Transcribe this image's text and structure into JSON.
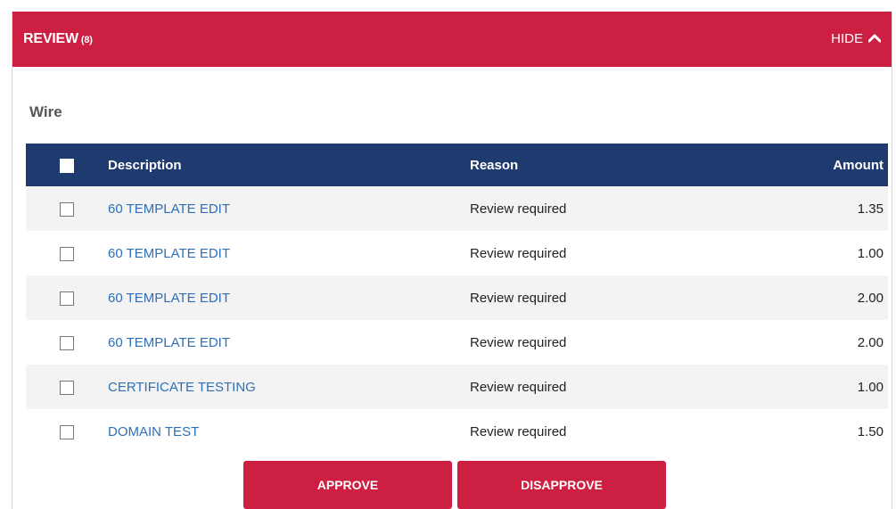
{
  "header": {
    "title": "REVIEW",
    "count": "(8)",
    "hide_label": "HIDE"
  },
  "section": {
    "title": "Wire"
  },
  "table": {
    "columns": {
      "description": "Description",
      "reason": "Reason",
      "amount": "Amount"
    },
    "rows": [
      {
        "description": "60 TEMPLATE EDIT",
        "reason": "Review required",
        "amount": "1.35"
      },
      {
        "description": "60 TEMPLATE EDIT",
        "reason": "Review required",
        "amount": "1.00"
      },
      {
        "description": "60 TEMPLATE EDIT",
        "reason": "Review required",
        "amount": "2.00"
      },
      {
        "description": "60 TEMPLATE EDIT",
        "reason": "Review required",
        "amount": "2.00"
      },
      {
        "description": "CERTIFICATE TESTING",
        "reason": "Review required",
        "amount": "1.00"
      },
      {
        "description": "DOMAIN TEST",
        "reason": "Review required",
        "amount": "1.50"
      }
    ]
  },
  "actions": {
    "approve_label": "APPROVE",
    "disapprove_label": "DISAPPROVE"
  },
  "colors": {
    "accent": "#cc1f42",
    "table_header": "#1f3a6e",
    "link": "#2e6fb7"
  }
}
